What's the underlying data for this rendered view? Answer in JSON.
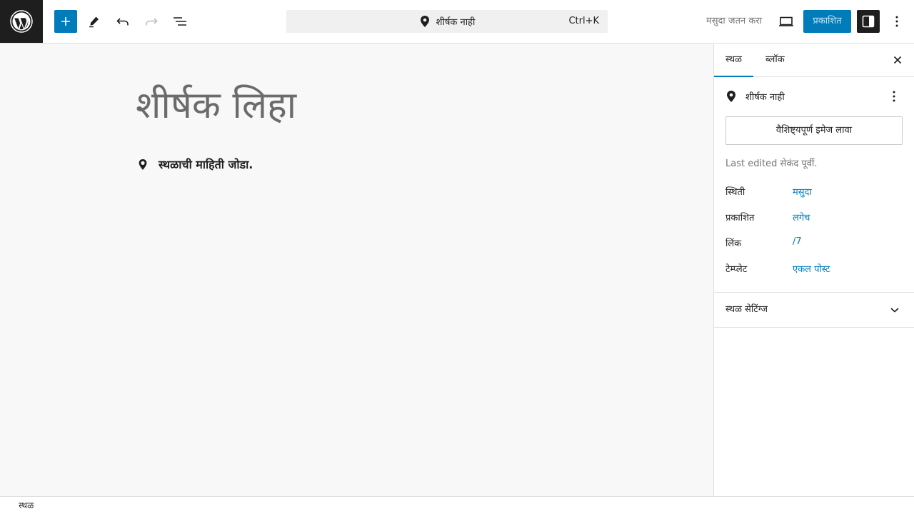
{
  "toolbar": {
    "logo": "wordpress-icon",
    "add_icon": "plus-icon",
    "tools_icon": "pen-icon",
    "undo_icon": "undo-icon",
    "redo_icon": "redo-icon",
    "list_view_icon": "list-view-icon"
  },
  "command_bar": {
    "title": "शीर्षक नाही",
    "shortcut": "Ctrl+K",
    "icon": "map-pin-icon"
  },
  "actions": {
    "save_draft": "मसुदा जतन करा",
    "publish": "प्रकाशित",
    "preview_icon": "laptop-icon",
    "settings_icon": "sidebar-icon",
    "options_icon": "more-vertical-icon"
  },
  "editor": {
    "title_placeholder": "शीर्षक लिहा",
    "location_prompt": "स्थळाची माहिती जोडा."
  },
  "sidebar": {
    "tabs": [
      {
        "label": "स्थळ",
        "active": true
      },
      {
        "label": "ब्लॉक",
        "active": false
      }
    ],
    "post_title": "शीर्षक नाही",
    "featured_image_button": "वैशिष्ट्यपूर्ण इमेज लावा",
    "last_edited": "Last edited सेकंद पूर्वी.",
    "rows": [
      {
        "label": "स्थिती",
        "value": "मसुदा"
      },
      {
        "label": "प्रकाशित",
        "value": "लगेच"
      },
      {
        "label": "लिंक",
        "value": "/7"
      },
      {
        "label": "टेम्प्लेट",
        "value": "एकल पोस्ट"
      }
    ],
    "panel_title": "स्थळ सेटिंग्ज"
  },
  "footer": {
    "breadcrumb": "स्थळ"
  },
  "colors": {
    "accent": "#007cba",
    "dark": "#1e1e1e",
    "canvas": "#f8f8f8"
  }
}
